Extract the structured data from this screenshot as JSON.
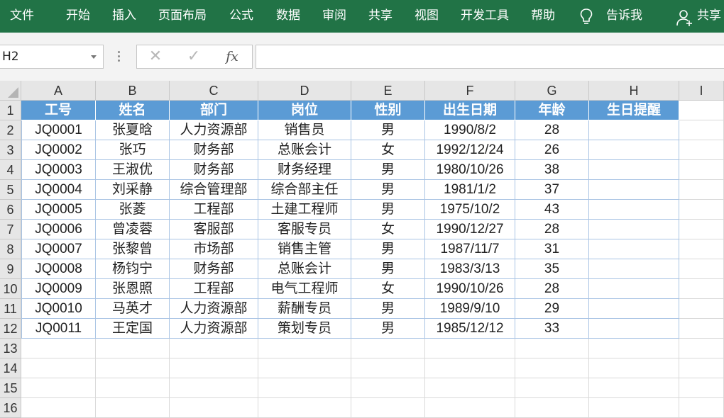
{
  "ribbon": {
    "tabs": [
      "文件",
      "开始",
      "插入",
      "页面布局",
      "公式",
      "数据",
      "审阅",
      "共享",
      "视图",
      "开发工具",
      "帮助"
    ],
    "tell_me": "告诉我",
    "share": "共享",
    "tab_icons": [
      "lightbulb-icon",
      "person-icon"
    ]
  },
  "formula_bar": {
    "name_box": "H2",
    "cancel_icon": "✕",
    "enter_icon": "✓",
    "fx_label": "fx",
    "formula": ""
  },
  "sheet": {
    "columns": [
      "A",
      "B",
      "C",
      "D",
      "E",
      "F",
      "G",
      "H",
      "I"
    ],
    "rows": [
      "1",
      "2",
      "3",
      "4",
      "5",
      "6",
      "7",
      "8",
      "9",
      "10",
      "11",
      "12",
      "13",
      "14",
      "15",
      "16"
    ],
    "header": [
      "工号",
      "姓名",
      "部门",
      "岗位",
      "性别",
      "出生日期",
      "年龄",
      "生日提醒"
    ],
    "data": [
      [
        "JQ0001",
        "张夏晗",
        "人力资源部",
        "销售员",
        "男",
        "1990/8/2",
        "28",
        ""
      ],
      [
        "JQ0002",
        "张巧",
        "财务部",
        "总账会计",
        "女",
        "1992/12/24",
        "26",
        ""
      ],
      [
        "JQ0003",
        "王淑优",
        "财务部",
        "财务经理",
        "男",
        "1980/10/26",
        "38",
        ""
      ],
      [
        "JQ0004",
        "刘采静",
        "综合管理部",
        "综合部主任",
        "男",
        "1981/1/2",
        "37",
        ""
      ],
      [
        "JQ0005",
        "张菱",
        "工程部",
        "土建工程师",
        "男",
        "1975/10/2",
        "43",
        ""
      ],
      [
        "JQ0006",
        "曾凌蓉",
        "客服部",
        "客服专员",
        "女",
        "1990/12/27",
        "28",
        ""
      ],
      [
        "JQ0007",
        "张黎曾",
        "市场部",
        "销售主管",
        "男",
        "1987/11/7",
        "31",
        ""
      ],
      [
        "JQ0008",
        "杨钧宁",
        "财务部",
        "总账会计",
        "男",
        "1983/3/13",
        "35",
        ""
      ],
      [
        "JQ0009",
        "张恩照",
        "工程部",
        "电气工程师",
        "女",
        "1990/10/26",
        "28",
        ""
      ],
      [
        "JQ0010",
        "马英才",
        "人力资源部",
        "薪酬专员",
        "男",
        "1989/9/10",
        "29",
        ""
      ],
      [
        "JQ0011",
        "王定国",
        "人力资源部",
        "策划专员",
        "男",
        "1985/12/12",
        "33",
        ""
      ]
    ]
  },
  "colors": {
    "ribbon": "#217346",
    "table_header": "#5b9bd5",
    "table_border": "#a9c4e4"
  }
}
